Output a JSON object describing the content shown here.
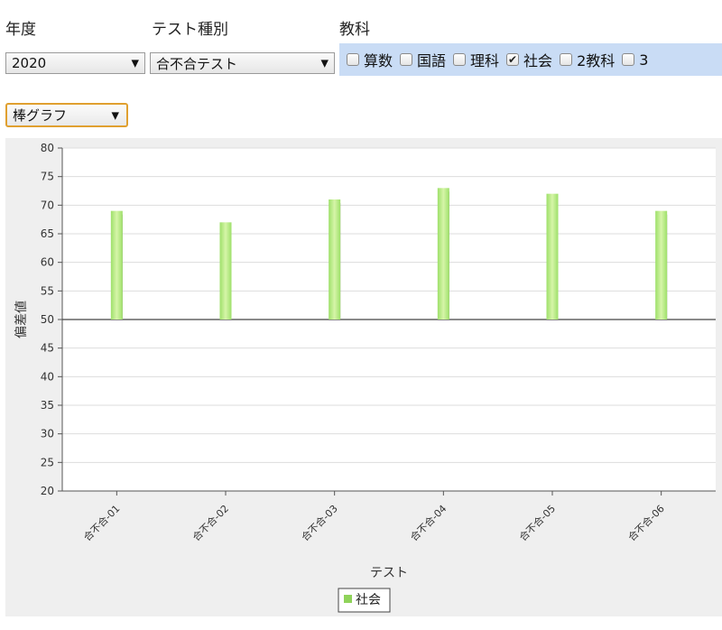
{
  "filters": {
    "year_label": "年度",
    "test_type_label": "テスト種別",
    "subject_label": "教科",
    "year_value": "2020",
    "test_type_value": "合不合テスト",
    "chart_type_value": "棒グラフ",
    "dropdown_arrow": "▼",
    "subjects": [
      {
        "label": "算数",
        "checked": false
      },
      {
        "label": "国語",
        "checked": false
      },
      {
        "label": "理科",
        "checked": false
      },
      {
        "label": "社会",
        "checked": true
      },
      {
        "label": "2教科",
        "checked": false
      },
      {
        "label": "3",
        "checked": false
      }
    ]
  },
  "chart_data": {
    "type": "bar",
    "categories": [
      "合不合-01",
      "合不合-02",
      "合不合-03",
      "合不合-04",
      "合不合-05",
      "合不合-06"
    ],
    "series": [
      {
        "name": "社会",
        "values": [
          69,
          67,
          71,
          73,
          72,
          69
        ]
      }
    ],
    "baseline": 50,
    "ylim": [
      20,
      80
    ],
    "yticks": [
      20,
      25,
      30,
      35,
      40,
      45,
      50,
      55,
      60,
      65,
      70,
      75,
      80
    ],
    "xlabel": "テスト",
    "ylabel": "偏差値",
    "grid": true,
    "legend_position": "bottom-center",
    "colors": {
      "bar": "#9ee06a",
      "bar_light": "#d6f5a8",
      "shadow": "#777777",
      "grid": "#dddddd",
      "axis": "#555555",
      "legend_swatch": "#8fd35a"
    }
  }
}
